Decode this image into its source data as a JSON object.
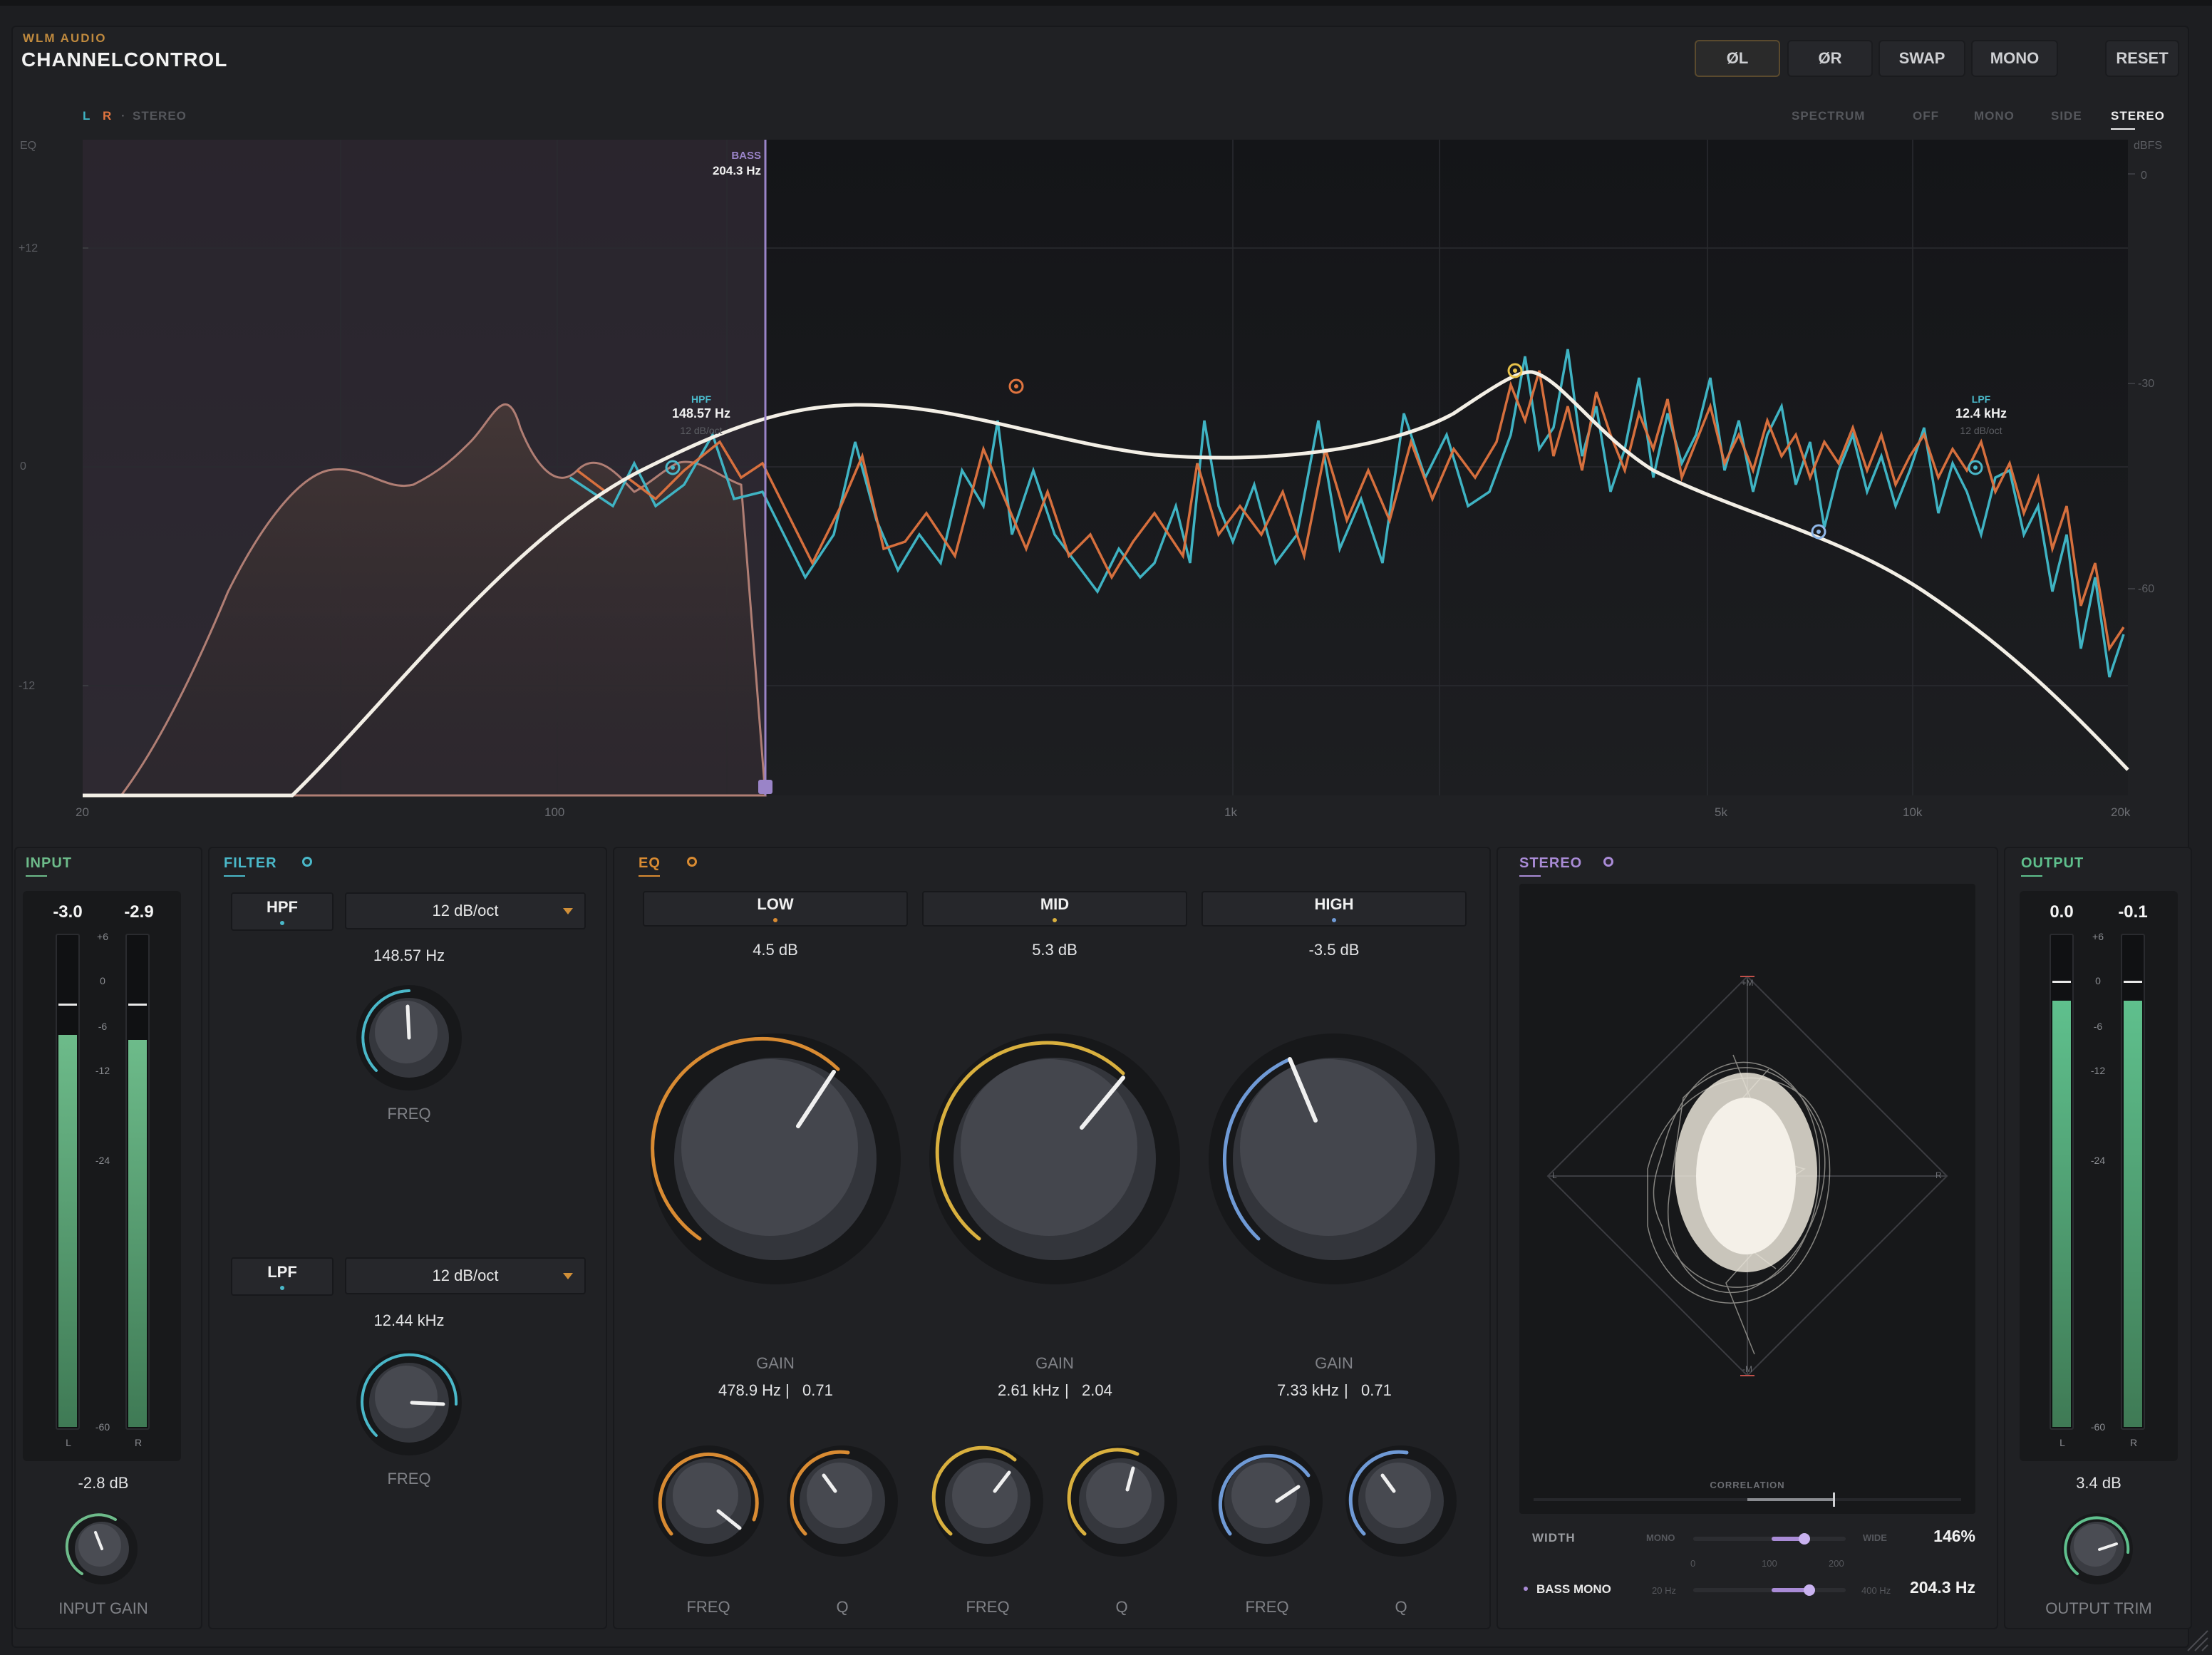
{
  "header": {
    "brand": "WLM AUDIO",
    "title": "CHANNELCONTROL",
    "buttons": [
      "ØL",
      "ØR",
      "SWAP",
      "MONO",
      "RESET"
    ]
  },
  "view": {
    "channels": {
      "l": "L",
      "r": "R",
      "sep": "·",
      "stereo": "STEREO"
    },
    "modes": [
      "SPECTRUM",
      "OFF",
      "MONO",
      "SIDE",
      "STEREO"
    ],
    "selected_mode": "STEREO"
  },
  "graph": {
    "eq_label": "EQ",
    "dbfs_label": "dBFS",
    "eq_scale": [
      "+12",
      "0",
      "-12"
    ],
    "dbfs_scale": [
      "0",
      "-30",
      "-60"
    ],
    "freq_labels": [
      "20",
      "100",
      "1k",
      "5k",
      "10k",
      "20k"
    ],
    "bass": {
      "label": "BASS",
      "value": "204.3 Hz"
    },
    "hpf": {
      "label": "HPF",
      "value": "148.57 Hz",
      "slope": "12 dB/oct"
    },
    "lpf": {
      "label": "LPF",
      "value": "12.4 kHz",
      "slope": "12 dB/oct"
    }
  },
  "input": {
    "title": "INPUT",
    "left_value": "-3.0",
    "right_value": "-2.9",
    "left_level": 0.8,
    "right_level": 0.79,
    "scale": [
      "+6",
      "0",
      "-6",
      "-12",
      "-24",
      "-60"
    ],
    "channel_labels": [
      "L",
      "R"
    ],
    "gain_value": "-2.8 dB",
    "gain_label": "INPUT GAIN"
  },
  "filter": {
    "title": "FILTER",
    "hpf": {
      "button": "HPF",
      "slope": "12 dB/oct",
      "value": "148.57 Hz",
      "knob_label": "FREQ"
    },
    "lpf": {
      "button": "LPF",
      "slope": "12 dB/oct",
      "value": "12.44 kHz",
      "knob_label": "FREQ"
    }
  },
  "eq": {
    "title": "EQ",
    "bands": [
      {
        "name": "LOW",
        "gain": "4.5 dB",
        "gain_label": "GAIN",
        "freq": "478.9 Hz",
        "sep": "|",
        "q": "0.71",
        "freq_label": "FREQ",
        "q_label": "Q",
        "color": "#d98b32"
      },
      {
        "name": "MID",
        "gain": "5.3 dB",
        "gain_label": "GAIN",
        "freq": "2.61 kHz",
        "sep": "|",
        "q": "2.04",
        "freq_label": "FREQ",
        "q_label": "Q",
        "color": "#d9b03e"
      },
      {
        "name": "HIGH",
        "gain": "-3.5 dB",
        "gain_label": "GAIN",
        "freq": "7.33 kHz",
        "sep": "|",
        "q": "0.71",
        "freq_label": "FREQ",
        "q_label": "Q",
        "color": "#6f9ad6"
      }
    ]
  },
  "stereo": {
    "title": "STEREO",
    "scope_labels": {
      "top": "+M",
      "bottom": "-M",
      "left": "L",
      "right": "R"
    },
    "correlation_label": "CORRELATION",
    "width": {
      "label": "WIDTH",
      "min": "MONO",
      "max": "WIDE",
      "value": "146%",
      "ticks": [
        "0",
        "100",
        "200"
      ],
      "fraction": 0.73
    },
    "bass_mono": {
      "label": "BASS MONO",
      "min": "20 Hz",
      "max": "400 Hz",
      "value": "204.3 Hz",
      "fraction": 0.76
    }
  },
  "output": {
    "title": "OUTPUT",
    "left_value": "0.0",
    "right_value": "-0.1",
    "left_level": 0.87,
    "right_level": 0.87,
    "scale": [
      "+6",
      "0",
      "-6",
      "-12",
      "-24",
      "-60"
    ],
    "channel_labels": [
      "L",
      "R"
    ],
    "trim_value": "3.4 dB",
    "trim_label": "OUTPUT TRIM"
  },
  "colors": {
    "left": "#3fb3c3",
    "right": "#e0743f",
    "input": "#6dbb8a",
    "filter": "#4ab8c9",
    "eq": "#d98b32",
    "stereo": "#a98bd6",
    "output": "#5fc08d"
  }
}
